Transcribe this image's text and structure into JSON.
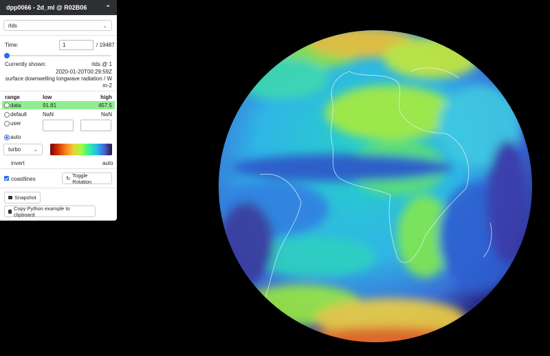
{
  "panel": {
    "title": "dpp0066 - 2d_ml @ R02B06",
    "variable": "rlds",
    "time_label": "Time:",
    "time_value": "1",
    "time_total": "/ 19487",
    "time_slider_fraction": 0,
    "currently_shown_label": "Currently shown:",
    "currently_shown_value": "rlds @ 1",
    "timestamp": "2020-01-20T00:29:59Z",
    "description": "surface downwelling longwave radiation / W m-2",
    "range": {
      "headers": {
        "range": "range",
        "low": "low",
        "high": "high"
      },
      "data": {
        "label": "data",
        "low": "91.81",
        "high": "457.5"
      },
      "default": {
        "label": "default",
        "low": "NaN",
        "high": "NaN"
      },
      "user": {
        "label": "user"
      },
      "auto": {
        "label": "auto"
      }
    },
    "colormap": "turbo",
    "invert_label": "invert",
    "auto_label": "auto",
    "coastlines_label": "coastlines",
    "toggle_rotation_label": "Toggle Rotation",
    "snapshot_label": "Snapshot",
    "copy_python_label": "Copy Python example to clipboard",
    "colors": {
      "header_bg": "#2e2f33",
      "data_row_bg": "#90ee90",
      "accent": "#2d6cdf"
    }
  },
  "icons": [
    "chevron-up-icon",
    "chevron-down-icon",
    "rotate-icon",
    "image-icon",
    "clipboard-icon"
  ]
}
